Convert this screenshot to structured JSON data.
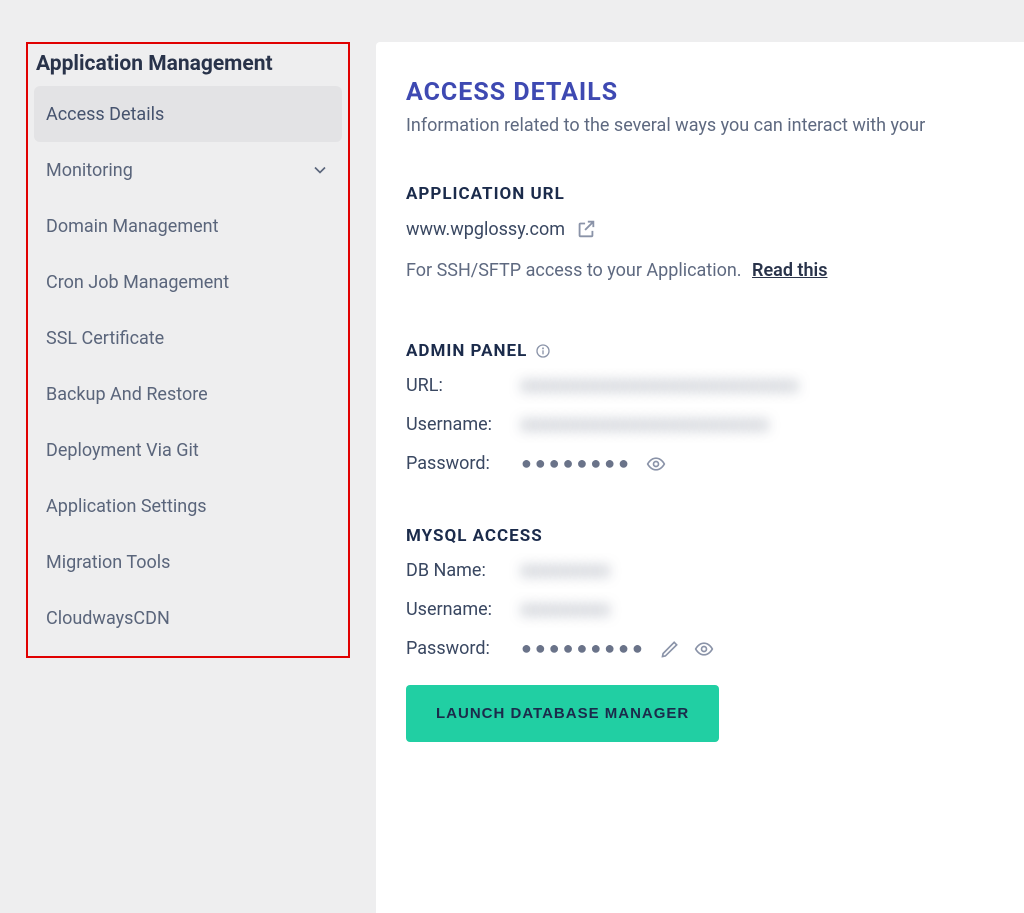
{
  "sidebar": {
    "title": "Application Management",
    "items": [
      {
        "label": "Access Details"
      },
      {
        "label": "Monitoring"
      },
      {
        "label": "Domain Management"
      },
      {
        "label": "Cron Job Management"
      },
      {
        "label": "SSL Certificate"
      },
      {
        "label": "Backup And Restore"
      },
      {
        "label": "Deployment Via Git"
      },
      {
        "label": "Application Settings"
      },
      {
        "label": "Migration Tools"
      },
      {
        "label": "CloudwaysCDN"
      }
    ]
  },
  "header": {
    "title": "ACCESS DETAILS",
    "subtitle": "Information related to the several ways you can interact with your"
  },
  "app_url": {
    "title": "APPLICATION URL",
    "value": "www.wpglossy.com",
    "ssh_text": "For SSH/SFTP access to your Application.",
    "read_this": "Read this"
  },
  "admin_panel": {
    "title": "ADMIN PANEL",
    "url_key": "URL:",
    "url_val": "xxxxxxxxxxxxxxxxxxxxxxxxxxxx",
    "username_key": "Username:",
    "username_val": "xxxxxxxxxxxxxxxxxxxxxxxxx",
    "password_key": "Password:",
    "password_val": "●●●●●●●●"
  },
  "mysql": {
    "title": "MYSQL ACCESS",
    "db_key": "DB Name:",
    "db_val": "xxxxxxxxx",
    "username_key": "Username:",
    "username_val": "xxxxxxxxx",
    "password_key": "Password:",
    "password_val": "●●●●●●●●●",
    "launch_btn": "LAUNCH DATABASE MANAGER"
  }
}
